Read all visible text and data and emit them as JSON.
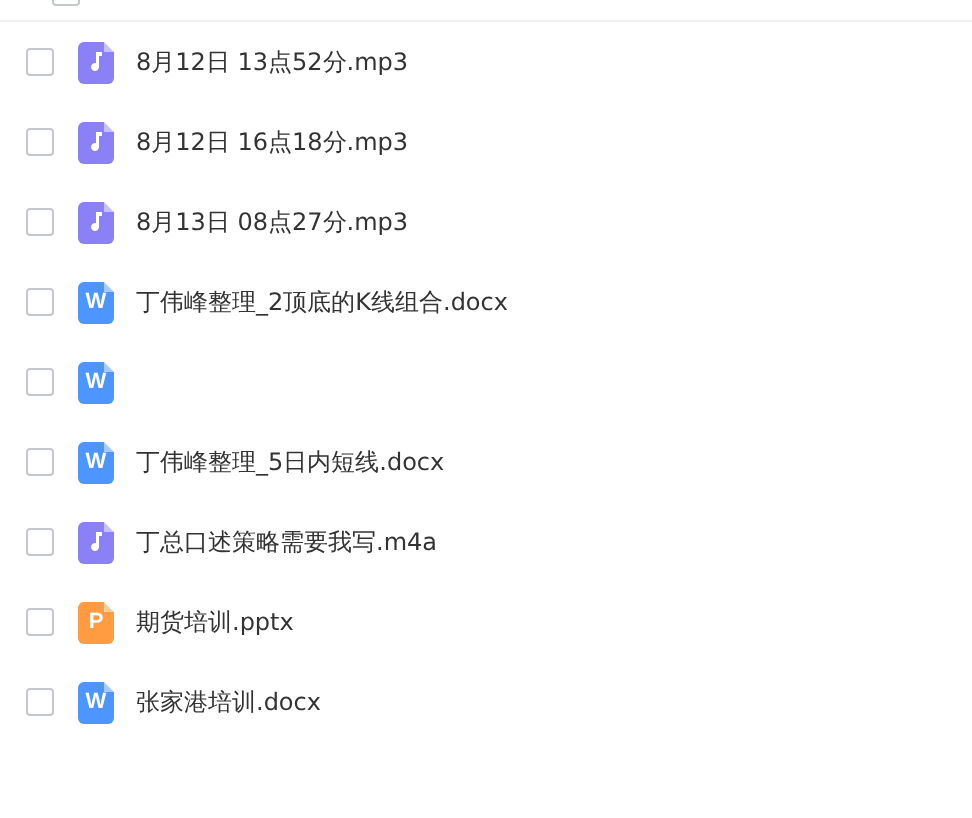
{
  "top_row": {
    "checked": false
  },
  "files": [
    {
      "kind": "audio",
      "name": "8月12日 13点52分.mp3",
      "checked": false
    },
    {
      "kind": "audio",
      "name": "8月12日 16点18分.mp3",
      "checked": false
    },
    {
      "kind": "audio",
      "name": "8月13日 08点27分.mp3",
      "checked": false
    },
    {
      "kind": "word",
      "icon_letter": "W",
      "name": "丁伟峰整理_2顶底的K线组合.docx",
      "checked": false
    },
    {
      "kind": "word",
      "icon_letter": "W",
      "checked": false
    },
    {
      "kind": "word",
      "icon_letter": "W",
      "name": "丁伟峰整理_5日内短线.docx",
      "checked": false
    },
    {
      "kind": "audio",
      "name": "丁总口述策略需要我写.m4a",
      "checked": false
    },
    {
      "kind": "ppt",
      "icon_letter": "P",
      "name": "期货培训.pptx",
      "checked": false
    },
    {
      "kind": "word",
      "icon_letter": "W",
      "name": "张家港培训.docx",
      "checked": false
    }
  ]
}
